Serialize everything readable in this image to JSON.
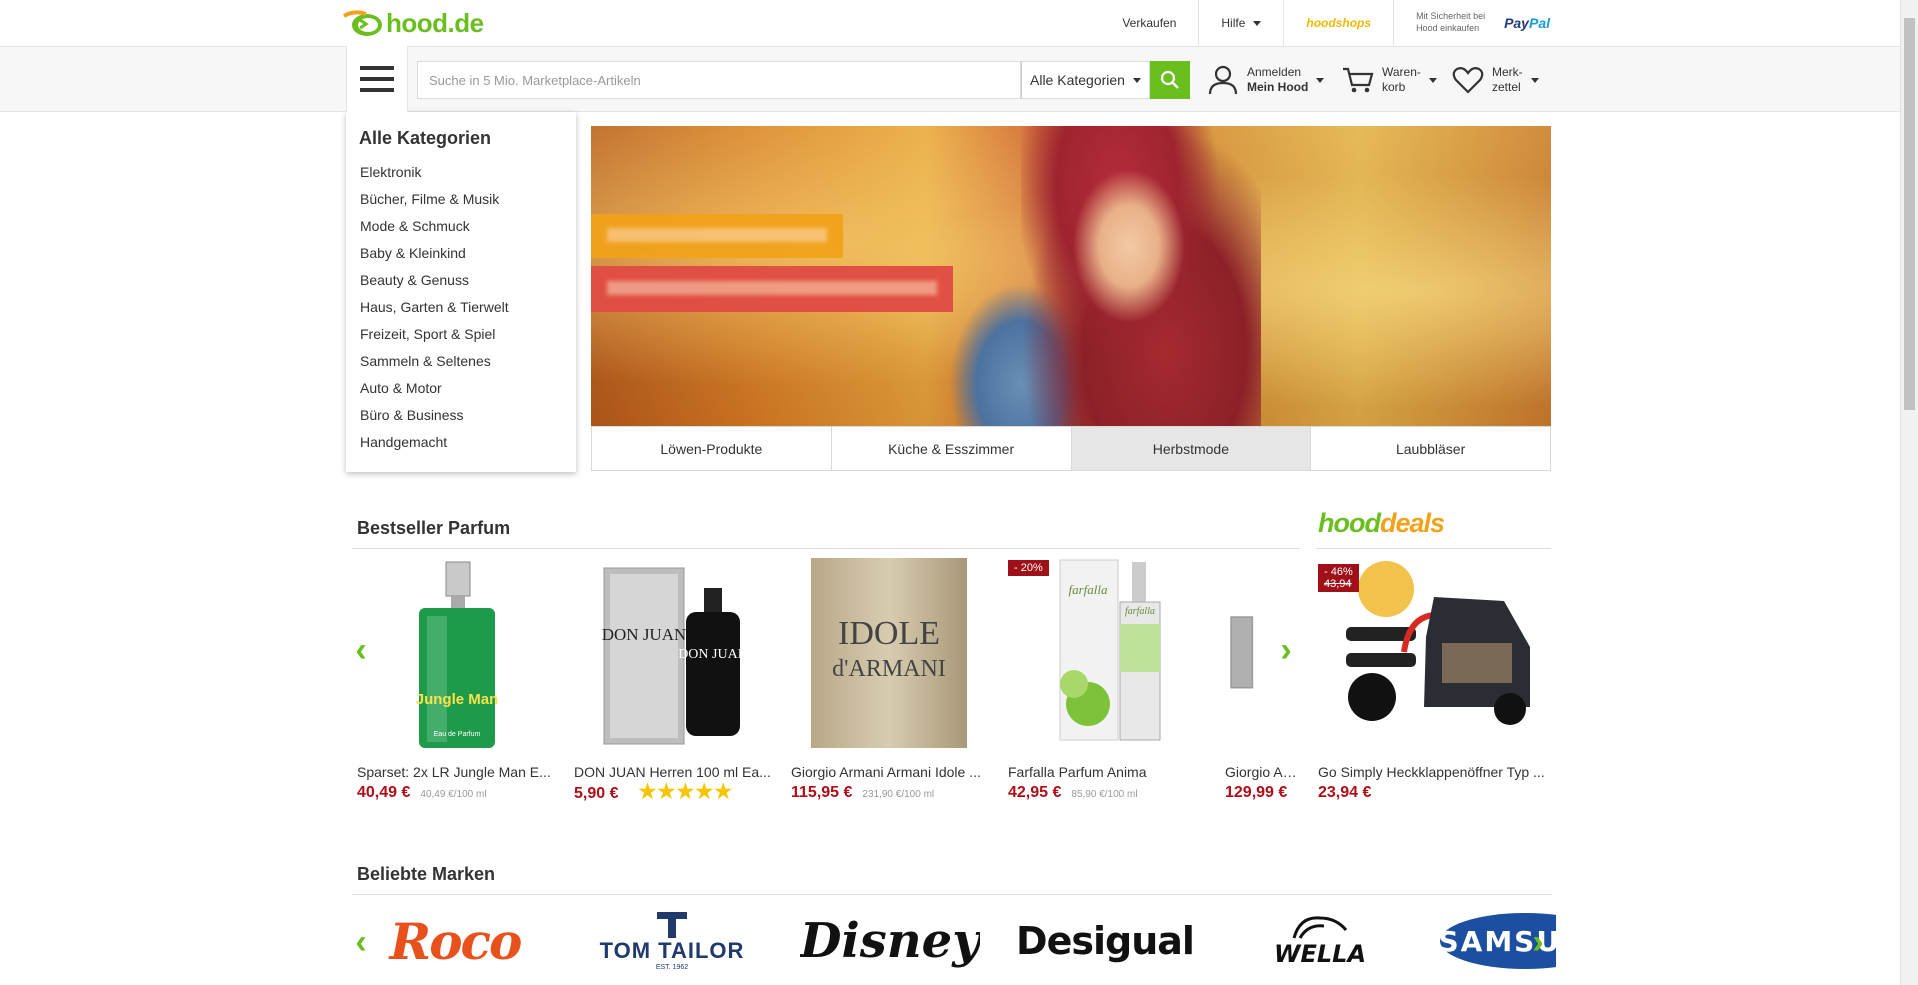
{
  "header": {
    "logo_text": "hood",
    "logo_tld": ".de",
    "links": {
      "sell": "Verkaufen",
      "help": "Hilfe",
      "hoodshops": "hoodshops"
    },
    "paypal_note": "Mit Sicherheit bei Hood einkaufen",
    "paypal_pay": "Pay",
    "paypal_pal": "Pal"
  },
  "search": {
    "placeholder": "Suche in 5 Mio. Marketplace-Artikeln",
    "category": "Alle Kategorien"
  },
  "account": {
    "login": "Anmelden",
    "my_hood": "Mein Hood"
  },
  "cart": {
    "line1": "Waren-",
    "line2": "korb"
  },
  "wishlist": {
    "line1": "Merk-",
    "line2": "zettel"
  },
  "categories": {
    "title": "Alle Kategorien",
    "items": [
      "Elektronik",
      "Bücher, Filme & Musik",
      "Mode & Schmuck",
      "Baby & Kleinkind",
      "Beauty & Genuss",
      "Haus, Garten & Tierwelt",
      "Freizeit, Sport & Spiel",
      "Sammeln & Seltenes",
      "Auto & Motor",
      "Büro & Business",
      "Handgemacht"
    ]
  },
  "hero": {
    "tabs": [
      "Löwen-Produkte",
      "Küche & Esszimmer",
      "Herbstmode",
      "Laubbläser"
    ],
    "active_tab": "Herbstmode"
  },
  "bestseller": {
    "title": "Bestseller Parfum",
    "products": [
      {
        "name": "Sparset: 2x LR Jungle Man E...",
        "price": "40,49 €",
        "unit": "40,49 €/100 ml"
      },
      {
        "name": "DON JUAN Herren 100 ml Ea...",
        "price": "5,90 €",
        "stars": "★★★★★"
      },
      {
        "name": "Giorgio Armani Armani Idole ...",
        "price": "115,95 €",
        "unit": "231,90 €/100 ml"
      },
      {
        "name": "Farfalla Parfum Anima",
        "price": "42,95 €",
        "unit": "85,90 €/100 ml",
        "badge": "- 20%"
      },
      {
        "name": "Giorgio Arma",
        "price": "129,99 €"
      }
    ]
  },
  "product_images": {
    "jungle_man": "Jungle Man",
    "jungle_sub": "Eau de Parfum",
    "don_juan": "DON JUAN",
    "idole_1": "IDOLE",
    "idole_2": "d'ARMANI",
    "farfalla": "farfalla"
  },
  "deals": {
    "logo_hood": "hood",
    "logo_deals": "deals",
    "product": {
      "name": "Go Simply Heckklappenöffner Typ ...",
      "price": "23,94 €",
      "badge": "- 46%",
      "old_price": "43,94"
    }
  },
  "brands": {
    "title": "Beliebte Marken",
    "items": [
      "Roco",
      "TOM TAILOR",
      "Disney",
      "Desigual",
      "WELLA",
      "SAMSUNG"
    ],
    "tomtailor_sub": "EST. 1962"
  },
  "colors": {
    "brand_green": "#6abf1e",
    "price_red": "#b00d16",
    "deal_orange": "#f2a21a"
  }
}
